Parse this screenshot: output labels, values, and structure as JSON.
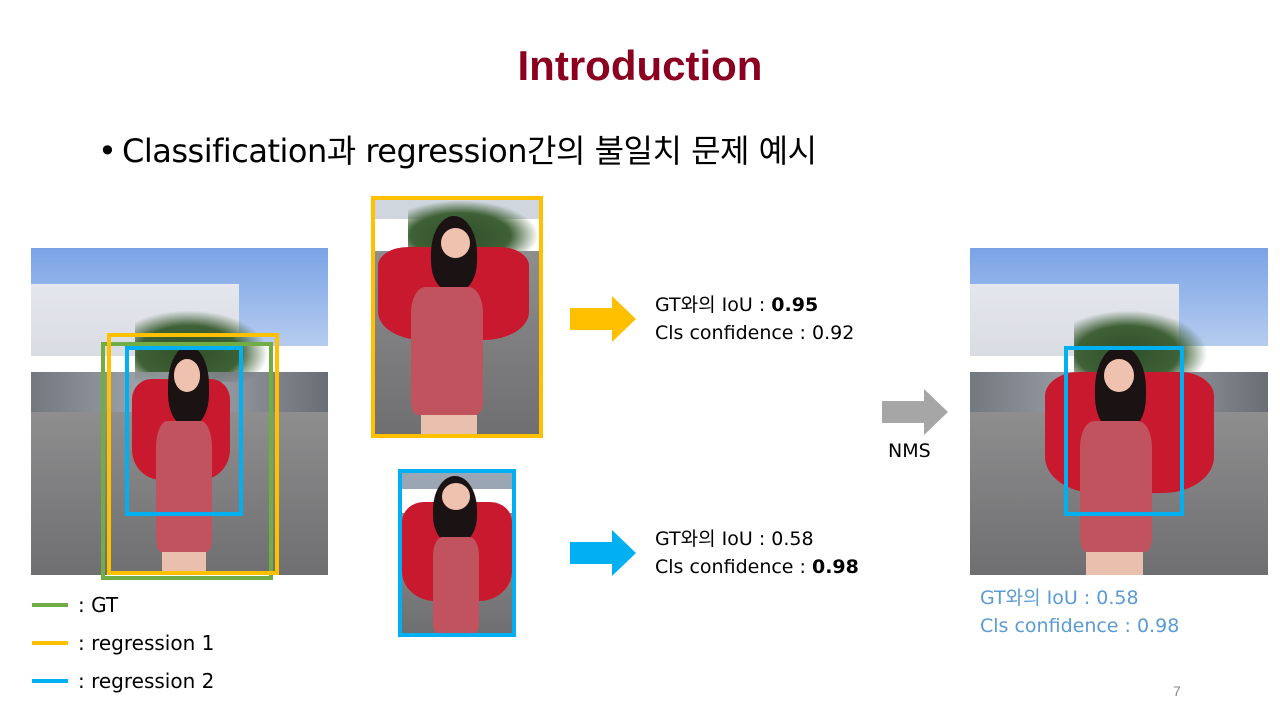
{
  "slide": {
    "title": "Introduction",
    "bullet": "Classification과 regression간의 불일치 문제 예시",
    "page_number": "7"
  },
  "colors": {
    "title": "#8b0020",
    "gt": "#70ad47",
    "regression1": "#ffc000",
    "regression2": "#00b0f0",
    "nms_arrow": "#a6a6a6",
    "result_text": "#5b9bd5"
  },
  "legend": [
    {
      "label": ": GT",
      "color_key": "gt"
    },
    {
      "label": ": regression 1",
      "color_key": "regression1"
    },
    {
      "label": ": regression 2",
      "color_key": "regression2"
    }
  ],
  "candidates": [
    {
      "name": "regression 1",
      "iou_label": "GT와의 IoU : ",
      "iou_value": "0.95",
      "conf_label": "Cls confidence : ",
      "conf_value": "0.92",
      "bold": "iou"
    },
    {
      "name": "regression 2",
      "iou_label": "GT와의 IoU : ",
      "iou_value": "0.58",
      "conf_label": "Cls confidence : ",
      "conf_value": "0.98",
      "bold": "conf"
    }
  ],
  "nms": {
    "label": "NMS"
  },
  "result": {
    "iou_text": "GT와의 IoU : 0.58",
    "conf_text": "Cls confidence : 0.98"
  },
  "images": {
    "original": "person-photo-with-boxes",
    "crop1": "crop-regression-1",
    "crop2": "crop-regression-2",
    "result": "person-photo-nms-result"
  }
}
